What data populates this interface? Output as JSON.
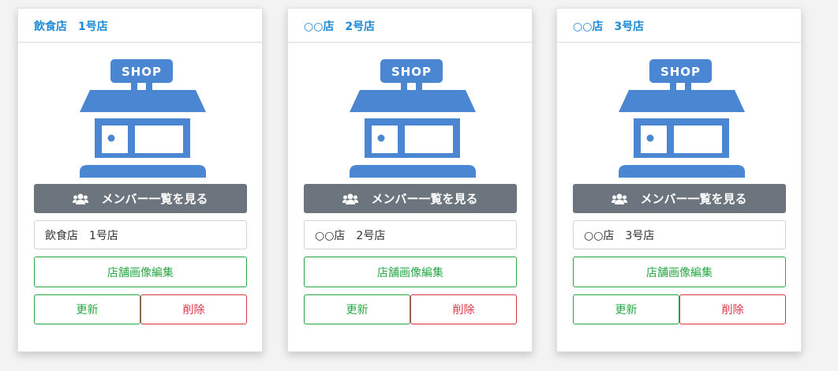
{
  "colors": {
    "header_title": "#1e8ad6",
    "shop_icon": "#4a86d2",
    "members_button": "#6c757d",
    "success": "#28a745",
    "danger": "#dc3545"
  },
  "icons": {
    "shop": "shop-storefront-icon",
    "members": "users-icon"
  },
  "shop_sign_text": "SHOP",
  "stores": [
    {
      "title": "飲食店　1号店",
      "members_label": "メンバー一覧を見る",
      "name_value": "飲食店　1号店",
      "edit_image_label": "店舗画像編集",
      "update_label": "更新",
      "delete_label": "削除"
    },
    {
      "title": "○○店　2号店",
      "members_label": "メンバー一覧を見る",
      "name_value": "○○店　2号店",
      "edit_image_label": "店舗画像編集",
      "update_label": "更新",
      "delete_label": "削除"
    },
    {
      "title": "○○店　3号店",
      "members_label": "メンバー一覧を見る",
      "name_value": "○○店　3号店",
      "edit_image_label": "店舗画像編集",
      "update_label": "更新",
      "delete_label": "削除"
    }
  ]
}
